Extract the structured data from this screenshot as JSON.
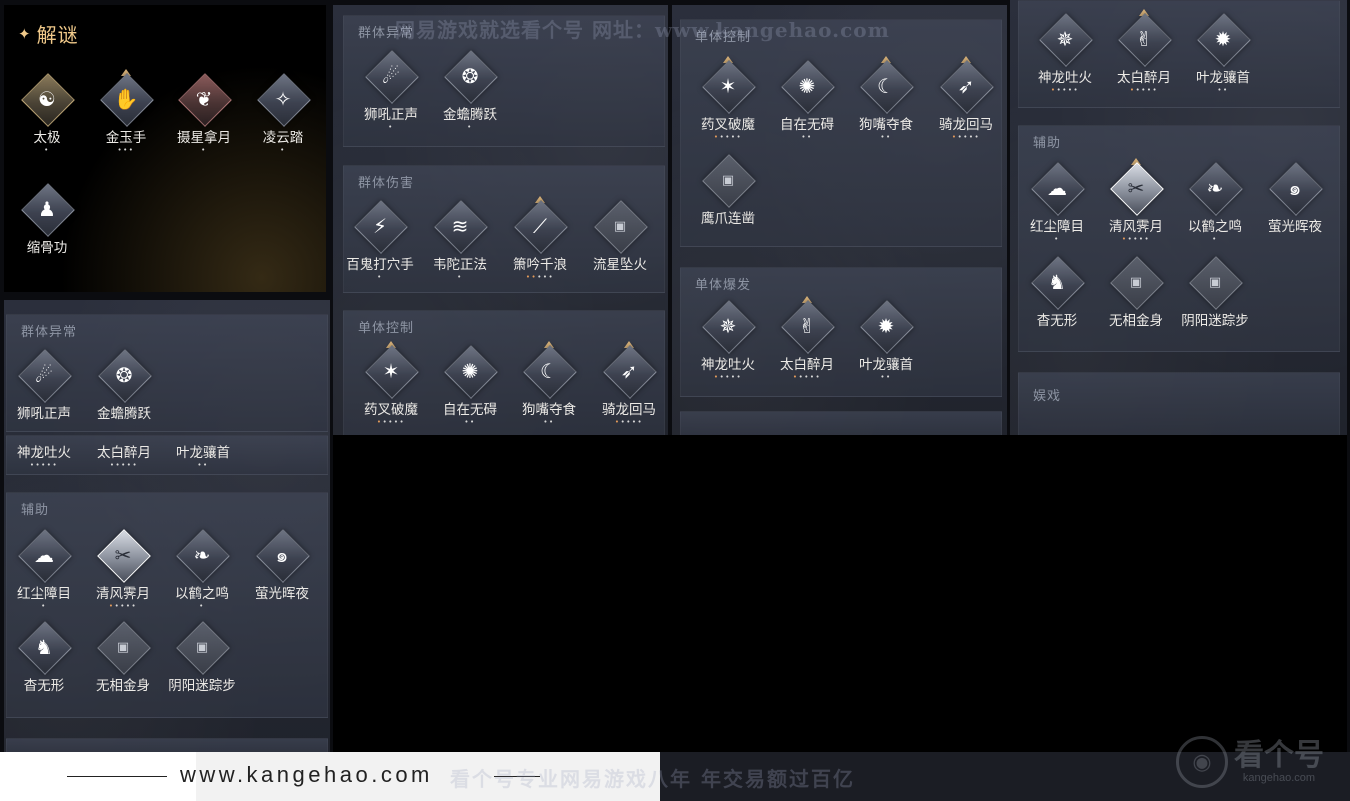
{
  "watermark": {
    "top": "网易游戏就选看个号  网址：www.kangehao.com",
    "bottom": "看个号专业网易游戏八年  年交易额过百亿",
    "site_url": "www.kangehao.com",
    "logo_text": "看个号",
    "logo_sub": "kangehao.com"
  },
  "puzzle_panel": {
    "title": "解谜",
    "skills": [
      {
        "name": "太极",
        "dots": "•"
      },
      {
        "name": "金玉手",
        "dots": "•••"
      },
      {
        "name": "摄星拿月",
        "dots": "•"
      },
      {
        "name": "凌云踏",
        "dots": "•"
      },
      {
        "name": "缩骨功",
        "dots": ""
      }
    ]
  },
  "sections": {
    "group_abnormal": "群体异常",
    "group_damage": "群体伤害",
    "single_control": "单体控制",
    "single_burst": "单体爆发",
    "support": "辅助",
    "play": "娱戏"
  },
  "skills": {
    "shihou": "狮吼正声",
    "jinchan": "金蟾腾跃",
    "baigui": "百鬼打穴手",
    "weituo": "韦陀正法",
    "xiaoyin": "箫吟千浪",
    "liuxing": "流星坠火",
    "yaocha": "药叉破魔",
    "zizai": "自在无碍",
    "goushi": "狗嘴夺食",
    "qilong": "骑龙回马",
    "yingzhua": "鹰爪连凿",
    "shenlong": "神龙吐火",
    "taibai": "太白醉月",
    "yelong": "叶龙骧首",
    "hongchen": "红尘障目",
    "qingfeng": "清风霁月",
    "yihe": "以鹤之鸣",
    "yingguang": "萤光晖夜",
    "yaowu": "杳无形",
    "wuxiang": "无相金身",
    "yinyang": "阴阳迷踪步"
  },
  "dots": {
    "one": "•",
    "two": "••",
    "five": "•••••",
    "five_orange_first": "•••••"
  },
  "icons": {
    "puzzle": "sparkle-icon",
    "locked": "lock-icon"
  },
  "colors": {
    "accent_gold": "#d8b27a",
    "title_gold": "#f0c98a",
    "dot_orange": "#e39a5a"
  }
}
